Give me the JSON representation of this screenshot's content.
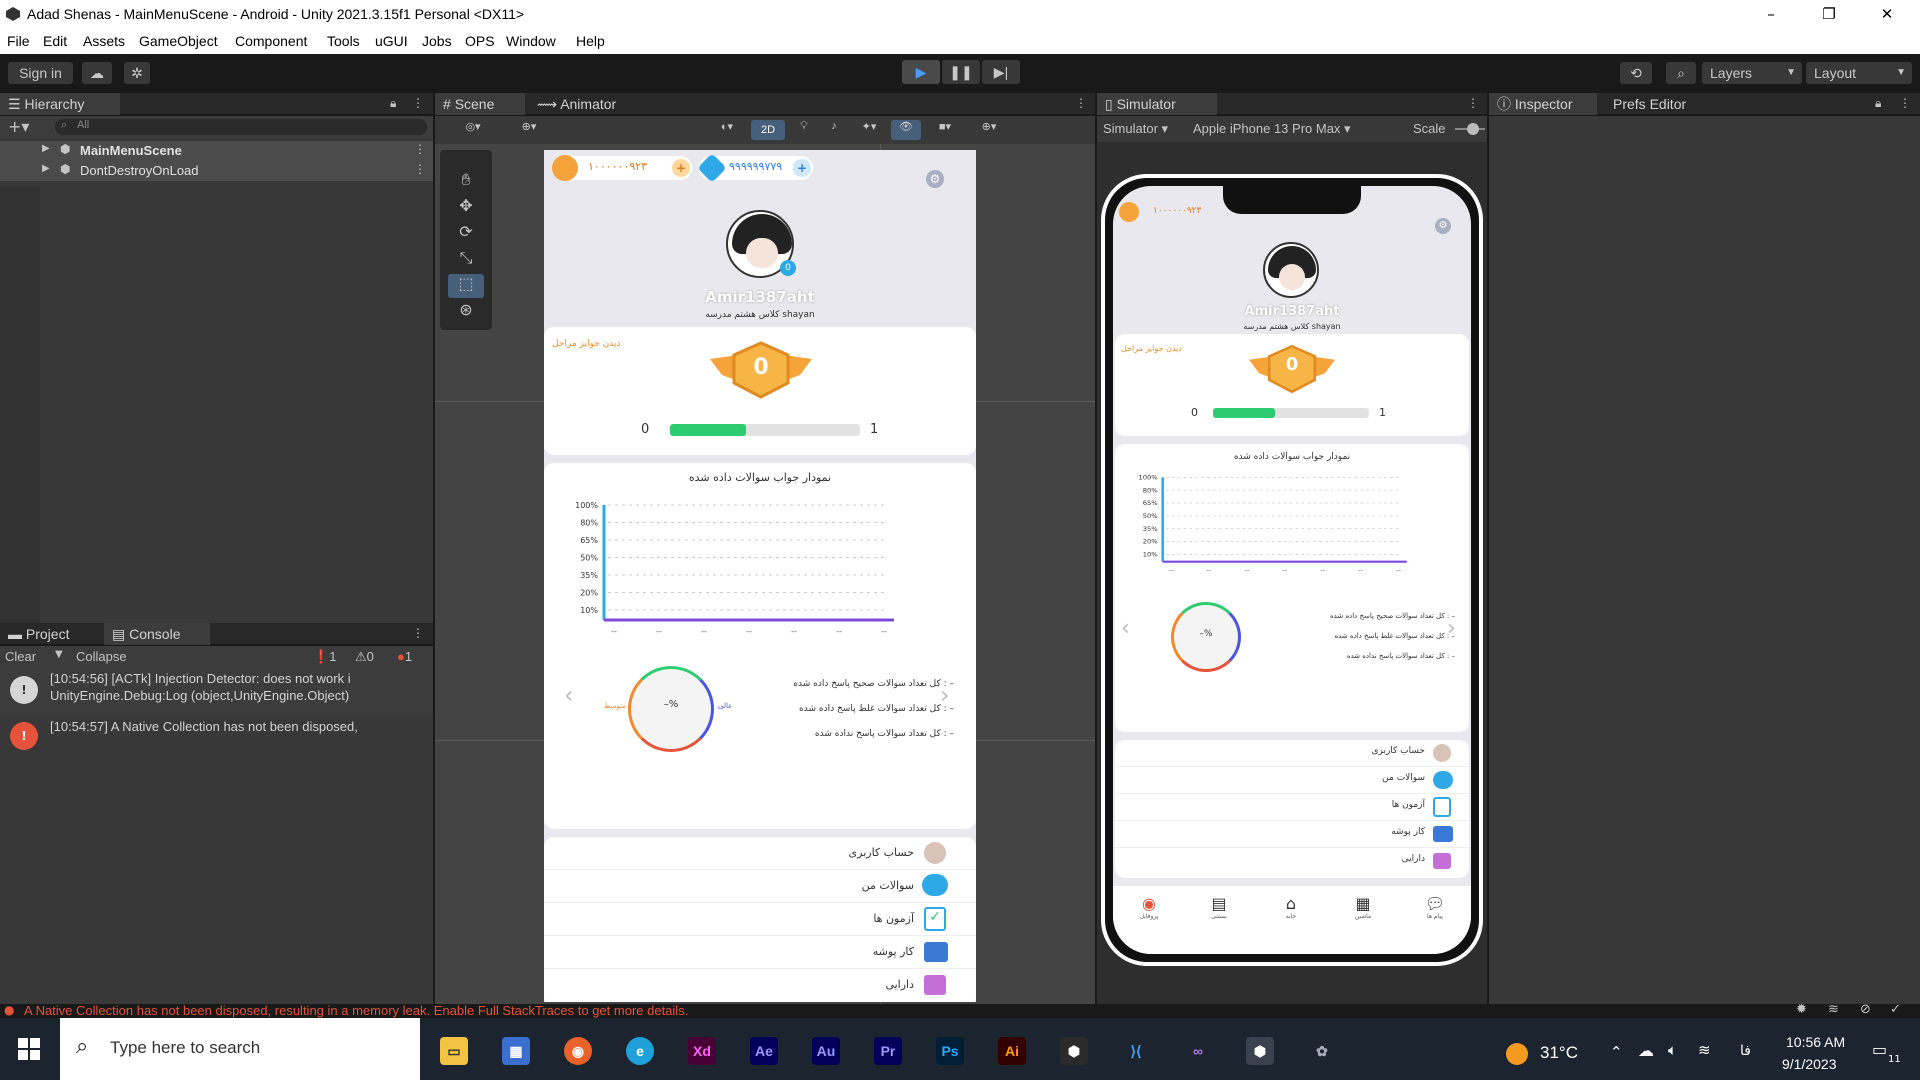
{
  "window": {
    "title": "Adad Shenas - MainMenuScene - Android - Unity 2021.3.15f1 Personal <DX11>"
  },
  "menu": [
    "File",
    "Edit",
    "Assets",
    "GameObject",
    "Component",
    "Tools",
    "uGUI",
    "Jobs",
    "OPS",
    "Window",
    "Help"
  ],
  "toolbar": {
    "sign_in": "Sign in",
    "layers": "Layers",
    "layout": "Layout"
  },
  "hierarchy": {
    "tab": "Hierarchy",
    "search_placeholder": "All",
    "items": [
      "MainMenuScene",
      "DontDestroyOnLoad"
    ]
  },
  "scene": {
    "tab": "Scene",
    "animator_tab": "Animator",
    "mode_2d": "2D"
  },
  "simulator": {
    "tab": "Simulator",
    "mode": "Simulator",
    "device": "Apple iPhone 13 Pro Max",
    "scale_label": "Scale"
  },
  "inspector": {
    "tab": "Inspector",
    "prefs_tab": "Prefs Editor"
  },
  "project": {
    "tab": "Project",
    "console_tab": "Console"
  },
  "console": {
    "clear": "Clear",
    "collapse": "Collapse",
    "count_info": "1",
    "count_warn": "0",
    "count_error": "1",
    "entries": [
      {
        "line1": "[10:54:56] [ACTk] Injection Detector: does not work i",
        "line2": "UnityEngine.Debug:Log (object,UnityEngine.Object)"
      },
      {
        "line1": "[10:54:57] A Native Collection has not been disposed,",
        "line2": ""
      }
    ]
  },
  "status": {
    "message": "A Native Collection has not been disposed, resulting in a memory leak. Enable Full StackTraces to get more details."
  },
  "game": {
    "coins": "۱۰۰۰۰۰۰۹۲۳",
    "gems": "۹۹۹۹۹۹۷۷۹",
    "coins_short": "۱۰۰۰۰۰۰۹۲۳",
    "username": "Amir1387aht",
    "class_info": "کلاس هشتم مدرسه shayan",
    "rewards_link": "دیدن جوایز مراحل",
    "level": "0",
    "progress_min": "0",
    "progress_max": "1",
    "progress_fraction": 0.4,
    "chart_title": "نمودار جواب سوالات داده شده",
    "stat_correct": "کل تعداد سوالات صحیح پاسخ داده شده : –",
    "stat_wrong": "کل تعداد سوالات غلط پاسخ داده شده : –",
    "stat_unanswered": "کل تعداد سوالات پاسخ نداده شده : –",
    "gauge_label": "–%",
    "gauge_mid": "متوسط",
    "gauge_good": "عالی",
    "menu_items": [
      "حساب کاربری",
      "سوالات من",
      "آزمون ها",
      "کار پوشه",
      "دارایی"
    ],
    "bottom_nav": [
      "پروفایل",
      "بستنی",
      "خانه",
      "ماشین",
      "پیام ها"
    ]
  },
  "chart_data": {
    "type": "line",
    "title": "نمودار جواب سوالات داده شده",
    "y_ticks": [
      "100%",
      "80%",
      "65%",
      "50%",
      "35%",
      "20%",
      "10%"
    ],
    "x_ticks": [
      "--",
      "--",
      "--",
      "--",
      "--",
      "--",
      "--"
    ],
    "series": []
  },
  "taskbar": {
    "search_placeholder": "Type here to search",
    "weather": "31°C",
    "lang": "فا",
    "time": "10:56 AM",
    "date": "9/1/2023",
    "notif": "11"
  },
  "colors": {
    "accent_blue": "#3a79d6",
    "error": "#e5533a",
    "progress": "#2ecc71"
  }
}
